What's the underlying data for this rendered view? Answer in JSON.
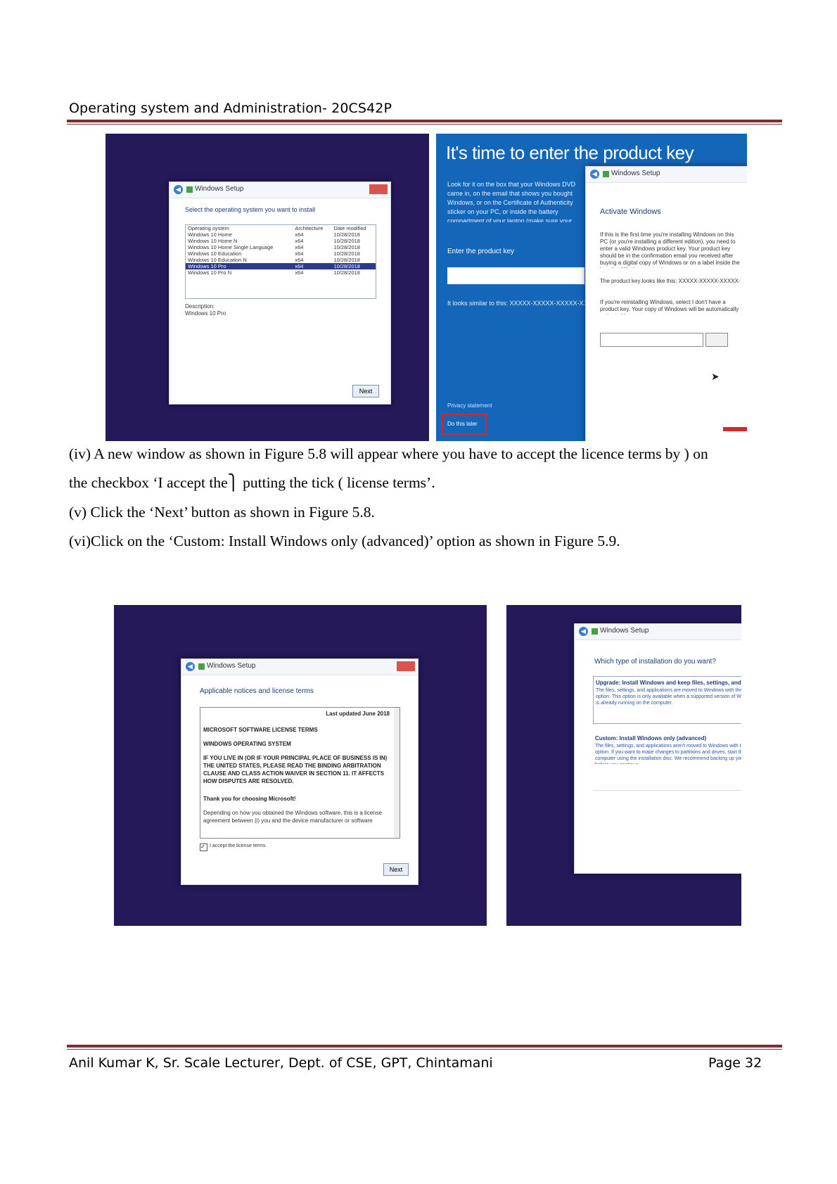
{
  "header": {
    "title": "Operating system and Administration- 20CS42P"
  },
  "figure_top": {
    "select_os": {
      "window_title": "Windows Setup",
      "heading": "Select the operating system you want to install",
      "columns": [
        "Operating system",
        "Architecture",
        "Date modified"
      ],
      "rows": [
        [
          "Windows 10 Home",
          "x64",
          "10/28/2018"
        ],
        [
          "Windows 10 Home N",
          "x64",
          "10/28/2018"
        ],
        [
          "Windows 10 Home Single Language",
          "x64",
          "10/28/2018"
        ],
        [
          "Windows 10 Education",
          "x64",
          "10/28/2018"
        ],
        [
          "Windows 10 Education N",
          "x64",
          "10/28/2018"
        ],
        [
          "Windows 10 Pro",
          "x64",
          "10/28/2018"
        ],
        [
          "Windows 10 Pro N",
          "x64",
          "10/28/2018"
        ]
      ],
      "selected_index": 5,
      "description_label": "Description:",
      "description_value": "Windows 10 Pro",
      "next_label": "Next"
    },
    "product_key": {
      "heading": "It's time to enter the product key",
      "intro": "Look for it on the box that your Windows DVD came in, on the email that shows you bought Windows, or on the Certificate of Authenticity sticker on your PC, or inside the battery compartment of your laptop (make sure your laptop is plugged in.)",
      "enter_label": "Enter the product key",
      "similar_text": "It looks similar to this: XXXXX-XXXXX-XXXXX-XXXXX-XXXXX",
      "privacy": "Privacy statement",
      "do_later": "Do this later",
      "dialog_title": "Windows Setup",
      "activate_heading": "Activate Windows",
      "activate_p1": "If this is the first time you're installing Windows on this PC (or you're installing a different edition), you need to enter a valid Windows product key. Your product key should be in the confirmation email you received after buying a digital copy of Windows or on a label inside the box that Windows came in.",
      "activate_p2": "The product key looks like this: XXXXX-XXXXX-XXXXX-XXXXX-XXXXX",
      "activate_p3": "If you're reinstalling Windows, select I don't have a product key. Your copy of Windows will be automatically activated later."
    }
  },
  "paragraphs": {
    "p1_line1": "(iv) A new window as shown in Figure 5.8 will appear where you have to accept the licence terms by ) on",
    "p1_line2": "the checkbox ‘I accept the⎫ putting the tick ( license terms’.",
    "p2": " (v) Click the ‘Next’ button as shown in Figure 5.8.",
    "p3": "(vi)Click on the ‘Custom: Install Windows only (advanced)’ option as shown in Figure 5.9."
  },
  "figure_bottom": {
    "license": {
      "window_title": "Windows Setup",
      "heading": "Applicable notices and license terms",
      "last_updated": "Last updated June 2018",
      "l1": "MICROSOFT SOFTWARE LICENSE TERMS",
      "l2": "WINDOWS OPERATING SYSTEM",
      "l3": "IF YOU LIVE IN (OR IF YOUR PRINCIPAL PLACE OF BUSINESS IS IN) THE UNITED STATES, PLEASE READ THE BINDING ARBITRATION CLAUSE AND CLASS ACTION WAIVER IN SECTION 11. IT AFFECTS HOW DISPUTES ARE RESOLVED.",
      "l4": "Thank you for choosing Microsoft!",
      "l5": "Depending on how you obtained the Windows software, this is a license agreement between (i) you and the device manufacturer or software installer",
      "accept": "I accept the license terms",
      "next_label": "Next"
    },
    "install_type": {
      "window_title": "Windows Setup",
      "heading": "Which type of installation do you want?",
      "upgrade_title": "Upgrade: Install Windows and keep files, settings, and applications",
      "upgrade_desc": "The files, settings, and applications are moved to Windows with this option. This option is only available when a supported version of Windows is already running on the computer.",
      "custom_title": "Custom: Install Windows only (advanced)",
      "custom_desc": "The files, settings, and applications aren't moved to Windows with this option. If you want to make changes to partitions and drives, start the computer using the installation disc. We recommend backing up your files before you continue."
    }
  },
  "footer": {
    "author": "Anil Kumar K, Sr. Scale Lecturer, Dept. of CSE, GPT, Chintamani",
    "page": "Page 32"
  }
}
